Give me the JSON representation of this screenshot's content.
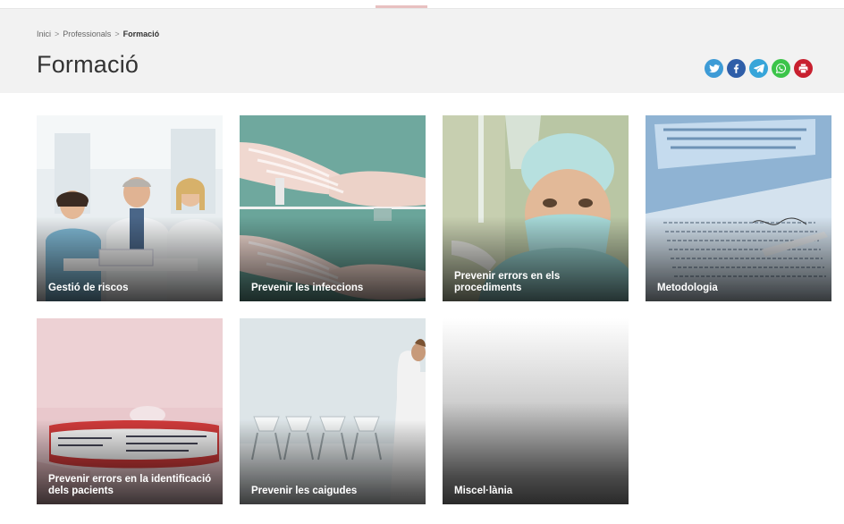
{
  "breadcrumb": {
    "items": [
      "Inici",
      "Professionals"
    ],
    "current": "Formació",
    "separator": ">"
  },
  "page": {
    "title": "Formació"
  },
  "share_icons": [
    "twitter-icon",
    "facebook-icon",
    "telegram-icon",
    "whatsapp-icon",
    "print-icon"
  ],
  "cards": [
    {
      "label": "Gestió de riscos"
    },
    {
      "label": "Prevenir les infeccions"
    },
    {
      "label": "Prevenir errors en els procediments"
    },
    {
      "label": "Metodologia"
    },
    {
      "label": "Prevenir errors en la identificació dels pacients"
    },
    {
      "label": "Prevenir les caigudes"
    },
    {
      "label": "Miscel·lània"
    }
  ],
  "colors": {
    "header_bg": "#f2f2f2",
    "twitter": "#3d9bd6",
    "facebook": "#2f5ea8",
    "telegram": "#37a5d9",
    "whatsapp": "#3cc44a",
    "print": "#c8202f"
  }
}
